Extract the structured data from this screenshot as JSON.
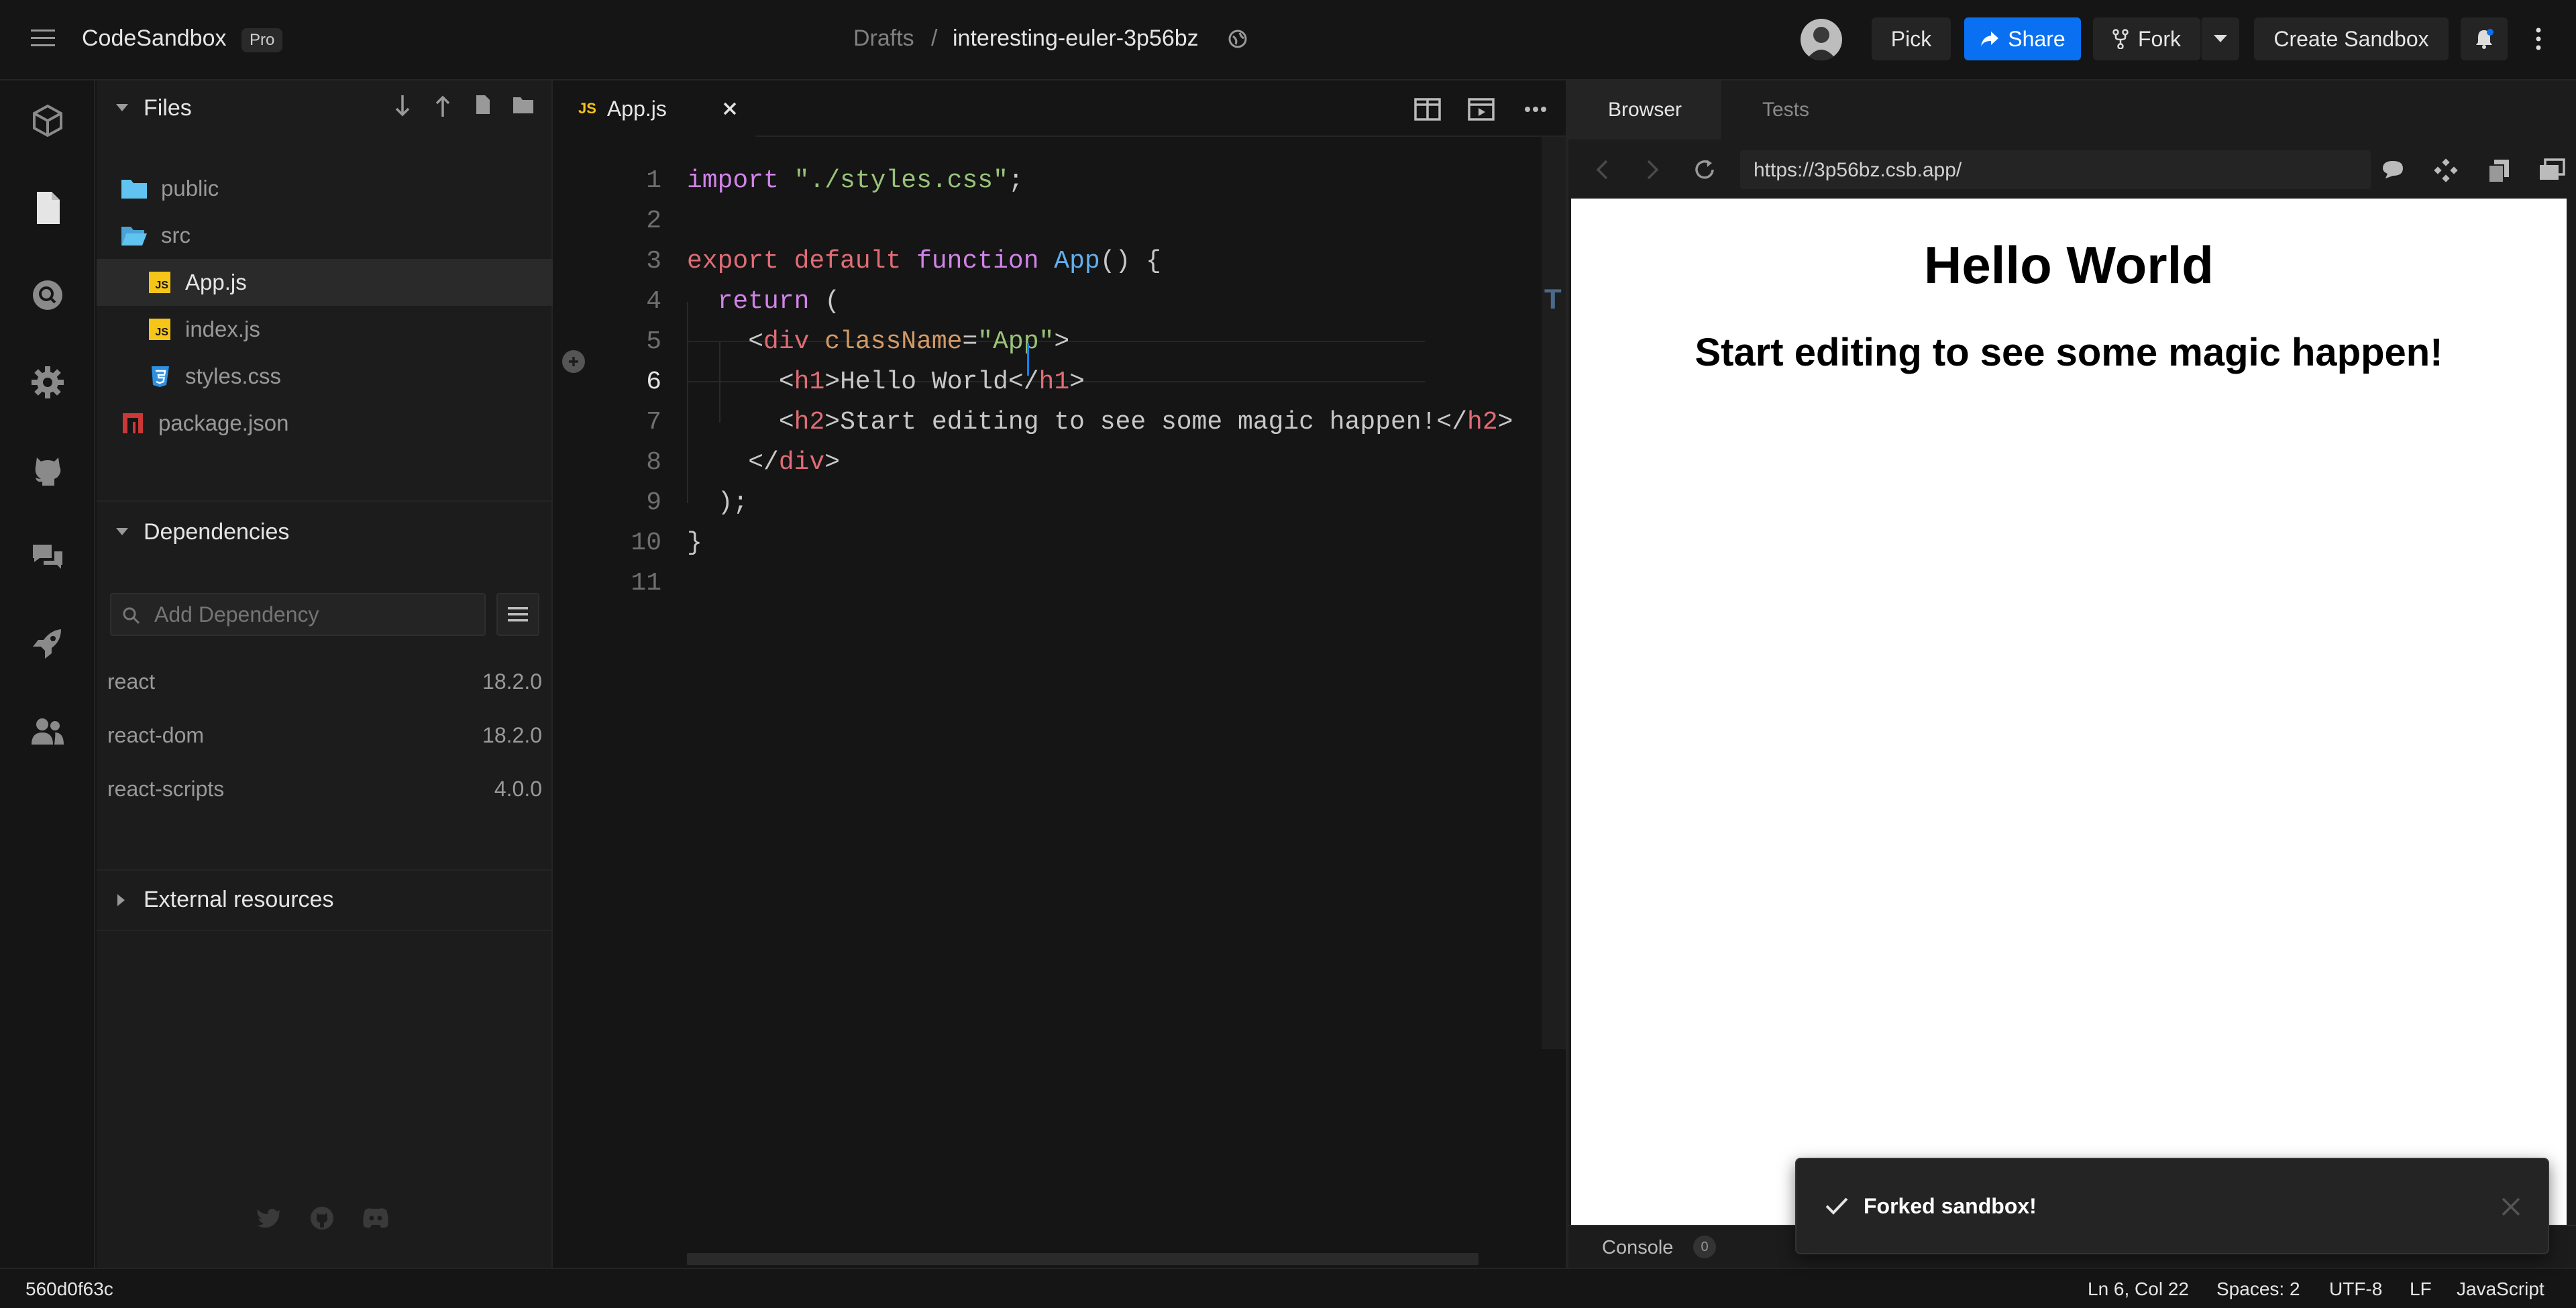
{
  "header": {
    "brand": "CodeSandbox",
    "plan_badge": "Pro",
    "breadcrumb_folder": "Drafts",
    "breadcrumb_separator": "/",
    "sandbox_name": "interesting-euler-3p56bz",
    "pick_label": "Pick",
    "share_label": "Share",
    "fork_label": "Fork",
    "create_label": "Create Sandbox"
  },
  "sidebar": {
    "files_title": "Files",
    "tree": [
      {
        "name": "public",
        "type": "folder"
      },
      {
        "name": "src",
        "type": "folder-open"
      },
      {
        "name": "App.js",
        "type": "js"
      },
      {
        "name": "index.js",
        "type": "js"
      },
      {
        "name": "styles.css",
        "type": "css"
      },
      {
        "name": "package.json",
        "type": "json"
      }
    ],
    "dependencies_title": "Dependencies",
    "add_dependency_placeholder": "Add Dependency",
    "dependencies": [
      {
        "name": "react",
        "version": "18.2.0"
      },
      {
        "name": "react-dom",
        "version": "18.2.0"
      },
      {
        "name": "react-scripts",
        "version": "4.0.0"
      }
    ],
    "external_resources_title": "External resources"
  },
  "editor": {
    "tab_badge": "JS",
    "tab_label": "App.js",
    "current_line": 6,
    "line_numbers": [
      "1",
      "2",
      "3",
      "4",
      "5",
      "6",
      "7",
      "8",
      "9",
      "10",
      "11"
    ]
  },
  "preview": {
    "tab_browser": "Browser",
    "tab_tests": "Tests",
    "url": "https://3p56bz.csb.app/",
    "h1": "Hello World",
    "h2": "Start editing to see some magic happen!",
    "console_label": "Console",
    "console_count": "0"
  },
  "toast": {
    "message": "Forked sandbox!"
  },
  "statusbar": {
    "commit": "560d0f63c",
    "cursor": "Ln 6, Col 22",
    "spaces": "Spaces: 2",
    "encoding": "UTF-8",
    "eol": "LF",
    "language": "JavaScript"
  },
  "colors": {
    "accent_blue": "#0971f1",
    "background": "#151515",
    "sidebar": "#1c1c1c"
  }
}
